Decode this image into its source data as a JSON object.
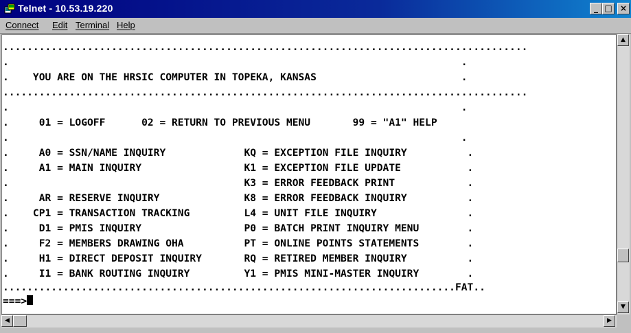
{
  "window": {
    "title": "Telnet - 10.53.19.220",
    "minimize": "_",
    "maximize": "□",
    "close": "×"
  },
  "menu": [
    "Connect",
    "Edit",
    "Terminal",
    "Help"
  ],
  "terminal": {
    "lines": [
      ".......................................................................................",
      ".                                                                           .",
      ".    YOU ARE ON THE HRSIC COMPUTER IN TOPEKA, KANSAS                        .",
      ".......................................................................................",
      ".                                                                           .",
      ".     01 = LOGOFF      02 = RETURN TO PREVIOUS MENU       99 = \"A1\" HELP",
      ".                                                                           .",
      ".     A0 = SSN/NAME INQUIRY             KQ = EXCEPTION FILE INQUIRY          .",
      ".     A1 = MAIN INQUIRY                 K1 = EXCEPTION FILE UPDATE           .",
      ".                                       K3 = ERROR FEEDBACK PRINT            .",
      ".     AR = RESERVE INQUIRY              K8 = ERROR FEEDBACK INQUIRY          .",
      ".    CP1 = TRANSACTION TRACKING         L4 = UNIT FILE INQUIRY               .",
      ".     D1 = PMIS INQUIRY                 P0 = BATCH PRINT INQUIRY MENU        .",
      ".     F2 = MEMBERS DRAWING OHA          PT = ONLINE POINTS STATEMENTS        .",
      ".     H1 = DIRECT DEPOSIT INQUIRY       RQ = RETIRED MEMBER INQUIRY          .",
      ".     I1 = BANK ROUTING INQUIRY         Y1 = PMIS MINI-MASTER INQUIRY        .",
      "...........................................................................FAT..",
      "===>"
    ]
  },
  "icons": {
    "app": "telnet-icon",
    "scroll_up": "▲",
    "scroll_down": "▼",
    "scroll_left": "◀",
    "scroll_right": "▶"
  },
  "colors": {
    "titlebar": "#000080",
    "chrome": "#c0c0c0",
    "screen": "#ffffff",
    "text": "#000000"
  }
}
